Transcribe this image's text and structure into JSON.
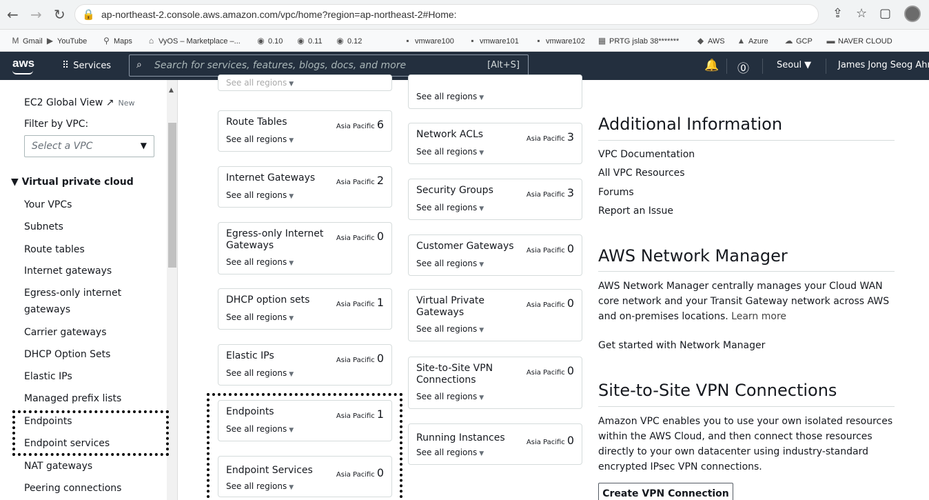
{
  "browser": {
    "url": "ap-northeast-2.console.aws.amazon.com/vpc/home?region=ap-northeast-2#Home:",
    "bookmarks": [
      {
        "label": "Gmail",
        "icon": "M"
      },
      {
        "label": "YouTube",
        "icon": "▶"
      },
      {
        "label": "Maps",
        "icon": "⚲"
      },
      {
        "label": "VyOS – Marketplace –...",
        "icon": "⌂"
      },
      {
        "label": "0.10",
        "icon": "◉"
      },
      {
        "label": "0.11",
        "icon": "◉"
      },
      {
        "label": "0.12",
        "icon": "◉"
      },
      {
        "label": "vmware100",
        "icon": "▪"
      },
      {
        "label": "vmware101",
        "icon": "▪"
      },
      {
        "label": "vmware102",
        "icon": "▪"
      },
      {
        "label": "PRTG jslab 38*******",
        "icon": "▦"
      },
      {
        "label": "AWS",
        "icon": "◆"
      },
      {
        "label": "Azure",
        "icon": "▲"
      },
      {
        "label": "GCP",
        "icon": "☁"
      },
      {
        "label": "NAVER CLOUD",
        "icon": "▬"
      }
    ]
  },
  "aws_header": {
    "logo": "aws",
    "services": "Services",
    "search_placeholder": "Search for services, features, blogs, docs, and more",
    "search_shortcut": "[Alt+S]",
    "region": "Seoul ▼",
    "user": "James Jong Seog Ahn"
  },
  "sidebar": {
    "clipped_top": "",
    "global_view": "EC2 Global View",
    "global_view_badge": "New",
    "filter_label": "Filter by VPC:",
    "select_placeholder": "Select a VPC",
    "section": "▼ Virtual private cloud",
    "items": [
      "Your VPCs",
      "Subnets",
      "Route tables",
      "Internet gateways",
      "Egress-only internet",
      "gateways",
      "Carrier gateways",
      "DHCP Option Sets",
      "Elastic IPs",
      "Managed prefix lists",
      "Endpoints",
      "Endpoint services",
      "NAT gateways",
      "Peering connections"
    ]
  },
  "cards": {
    "region_label": "Asia Pacific",
    "see_all": "See all regions",
    "left": [
      {
        "name": "",
        "count": ""
      },
      {
        "name": "Route Tables",
        "count": "6"
      },
      {
        "name": "Internet Gateways",
        "count": "2"
      },
      {
        "name": "Egress-only Internet Gateways",
        "count": "0"
      },
      {
        "name": "DHCP option sets",
        "count": "1"
      },
      {
        "name": "Elastic IPs",
        "count": "0"
      },
      {
        "name": "Endpoints",
        "count": "1"
      },
      {
        "name": "Endpoint Services",
        "count": "0"
      }
    ],
    "right": [
      {
        "name": "",
        "count": ""
      },
      {
        "name": "Network ACLs",
        "count": "3"
      },
      {
        "name": "Security Groups",
        "count": "3"
      },
      {
        "name": "Customer Gateways",
        "count": "0"
      },
      {
        "name": "Virtual Private Gateways",
        "count": "0"
      },
      {
        "name": "Site-to-Site VPN Connections",
        "count": "0"
      },
      {
        "name": "Running Instances",
        "count": "0"
      }
    ]
  },
  "info": {
    "additional_title": "Additional Information",
    "links": [
      "VPC Documentation",
      "All VPC Resources",
      "Forums",
      "Report an Issue"
    ],
    "nm_title": "AWS Network Manager",
    "nm_text": "AWS Network Manager centrally manages your Cloud WAN core network and your Transit Gateway network across AWS and on-premises locations.",
    "nm_learn": "Learn more",
    "nm_link": "Get started with Network Manager",
    "vpn_title": "Site-to-Site VPN Connections",
    "vpn_text": "Amazon VPC enables you to use your own isolated resources within the AWS Cloud, and then connect those resources directly to your own datacenter using industry-standard encrypted IPsec VPN connections.",
    "vpn_button": "Create VPN Connection"
  },
  "colors": {
    "aws_header": "#232f3e",
    "link": "#0073bb",
    "highlight": "#000000"
  }
}
